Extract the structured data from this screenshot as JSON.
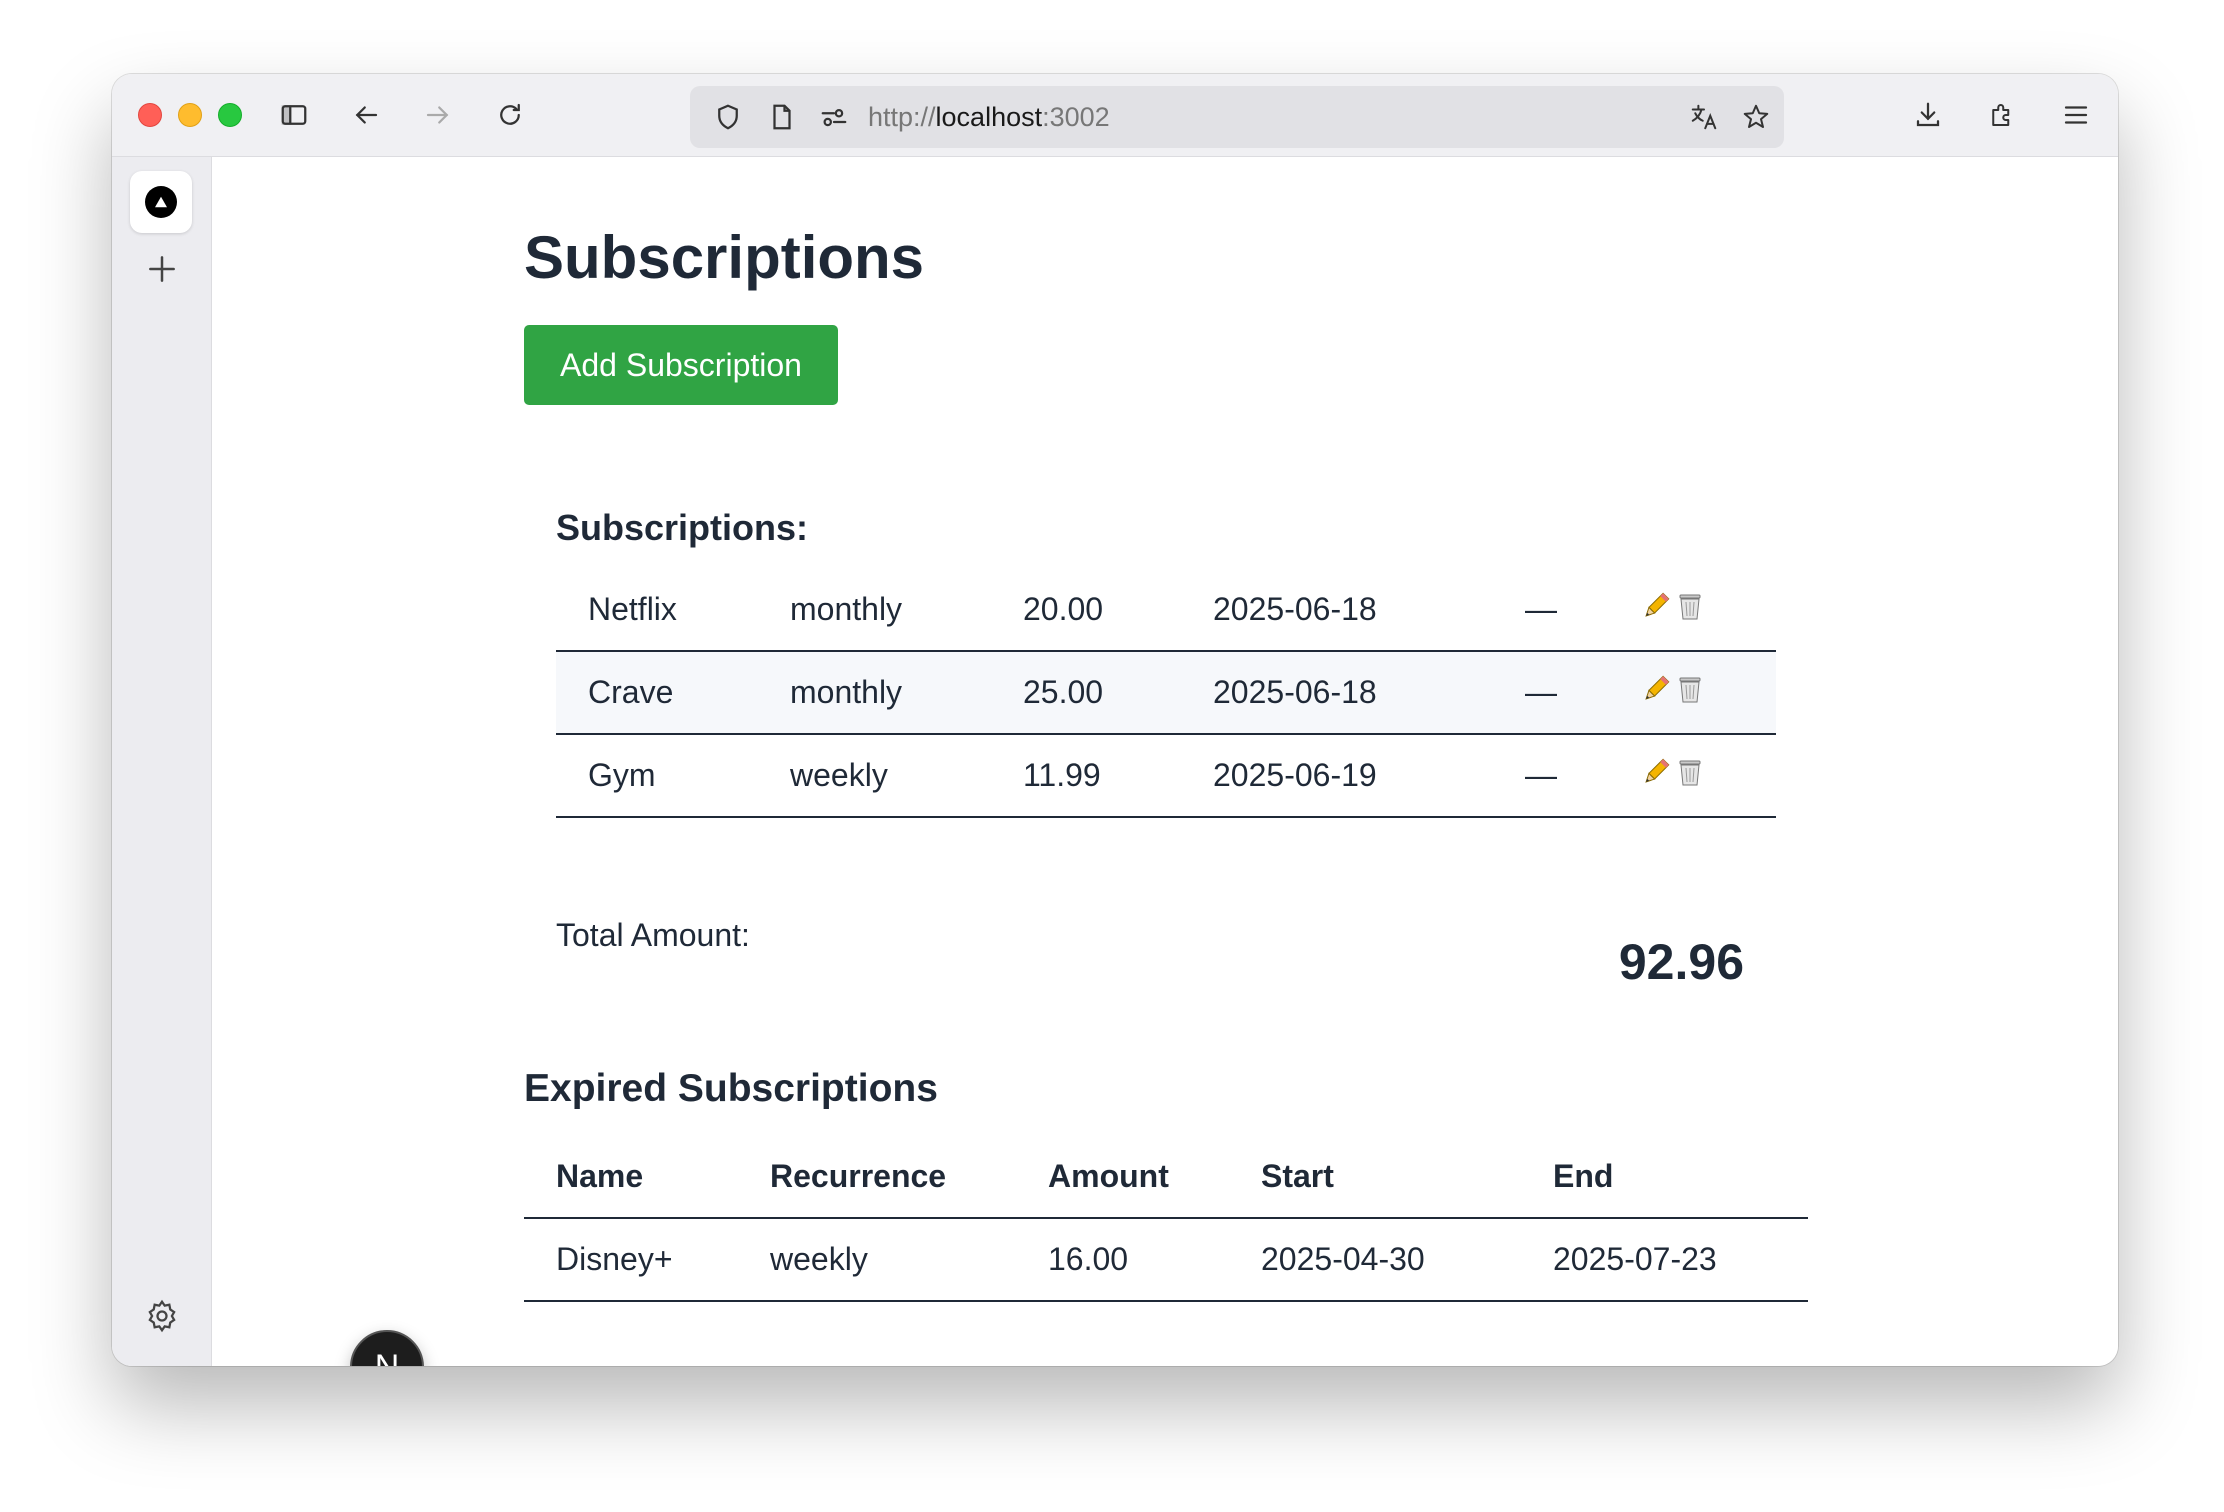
{
  "browser": {
    "url_scheme": "http://",
    "url_host": "localhost",
    "url_port": ":3002"
  },
  "page": {
    "title": "Subscriptions",
    "add_button_label": "Add Subscription"
  },
  "active": {
    "heading": "Subscriptions:",
    "rows": [
      {
        "name": "Netflix",
        "recurrence": "monthly",
        "amount": "20.00",
        "start": "2025-06-18",
        "end": "—"
      },
      {
        "name": "Crave",
        "recurrence": "monthly",
        "amount": "25.00",
        "start": "2025-06-18",
        "end": "—"
      },
      {
        "name": "Gym",
        "recurrence": "weekly",
        "amount": "11.99",
        "start": "2025-06-19",
        "end": "—"
      }
    ],
    "total_label": "Total Amount:",
    "total_value": "92.96"
  },
  "expired": {
    "heading": "Expired Subscriptions",
    "columns": [
      "Name",
      "Recurrence",
      "Amount",
      "Start",
      "End"
    ],
    "rows": [
      {
        "name": "Disney+",
        "recurrence": "weekly",
        "amount": "16.00",
        "start": "2025-04-30",
        "end": "2025-07-23"
      }
    ]
  },
  "dev_badge": {
    "letter": "N"
  },
  "colors": {
    "add_button": "#30a444",
    "text": "#1f2937"
  },
  "icons": {
    "edit": "pencil-icon",
    "delete": "wastebasket-icon"
  }
}
